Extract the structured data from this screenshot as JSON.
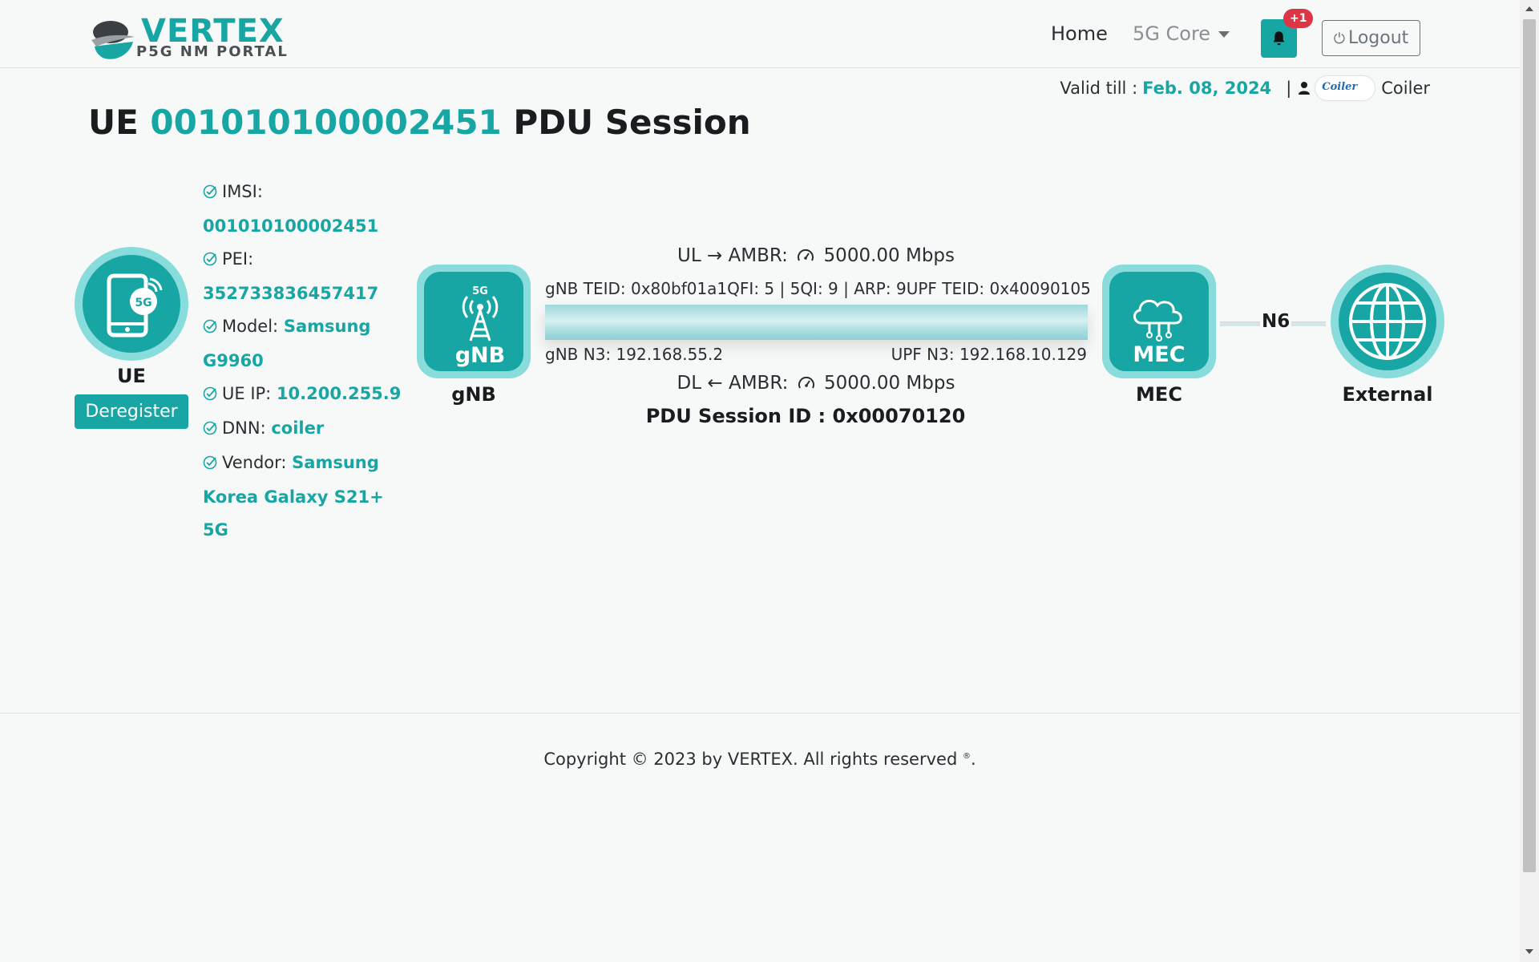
{
  "header": {
    "brand_name": "VERTEX",
    "brand_sub": "P5G NM PORTAL",
    "nav_home": "Home",
    "nav_core": "5G Core",
    "notification_badge": "+1",
    "logout_label": "Logout"
  },
  "account": {
    "valid_label": "Valid till :",
    "valid_date": "Feb. 08, 2024",
    "separator": "|",
    "avatar_text": "Coiler",
    "user_name": "Coiler"
  },
  "title": {
    "prefix": "UE",
    "ue_id": "001010100002451",
    "suffix": "PDU Session"
  },
  "ue": {
    "label": "UE",
    "deregister_label": "Deregister",
    "imsi_label": "IMSI:",
    "imsi": "001010100002451",
    "pei_label": "PEI:",
    "pei": "352733836457417",
    "model_label": "Model:",
    "model": "Samsung G9960",
    "ip_label": "UE IP:",
    "ip": "10.200.255.9",
    "dnn_label": "DNN:",
    "dnn": "coiler",
    "vendor_label": "Vendor:",
    "vendor": "Samsung Korea Galaxy S21+ 5G"
  },
  "session": {
    "ul_text": "UL → AMBR:",
    "ul_value": "5000.00 Mbps",
    "dl_text": "DL ← AMBR:",
    "dl_value": "5000.00 Mbps",
    "gnb_teid": "gNB TEID: 0x80bf01a1",
    "qos": "QFI: 5 | 5QI: 9 | ARP: 9",
    "upf_teid": "UPF TEID: 0x40090105",
    "gnb_n3": "gNB N3: 192.168.55.2",
    "upf_n3": "UPF N3: 192.168.10.129",
    "pdu_session_id": "PDU Session ID : 0x00070120"
  },
  "nodes": {
    "gnb_label": "gNB",
    "gnb_icon_text": "gNB",
    "gnb_icon_5g": "5G",
    "ue_icon_5g": "5G",
    "mec_label": "MEC",
    "mec_icon_text": "MEC",
    "external_label": "External",
    "n6_label": "N6"
  },
  "footer": {
    "copyright": "Copyright © 2023 by VERTEX. All rights reserved",
    "reg_mark": "®",
    "period": "."
  },
  "colors": {
    "accent": "#17a6a3",
    "accent_light": "#88dcdb",
    "badge": "#dc3545"
  }
}
